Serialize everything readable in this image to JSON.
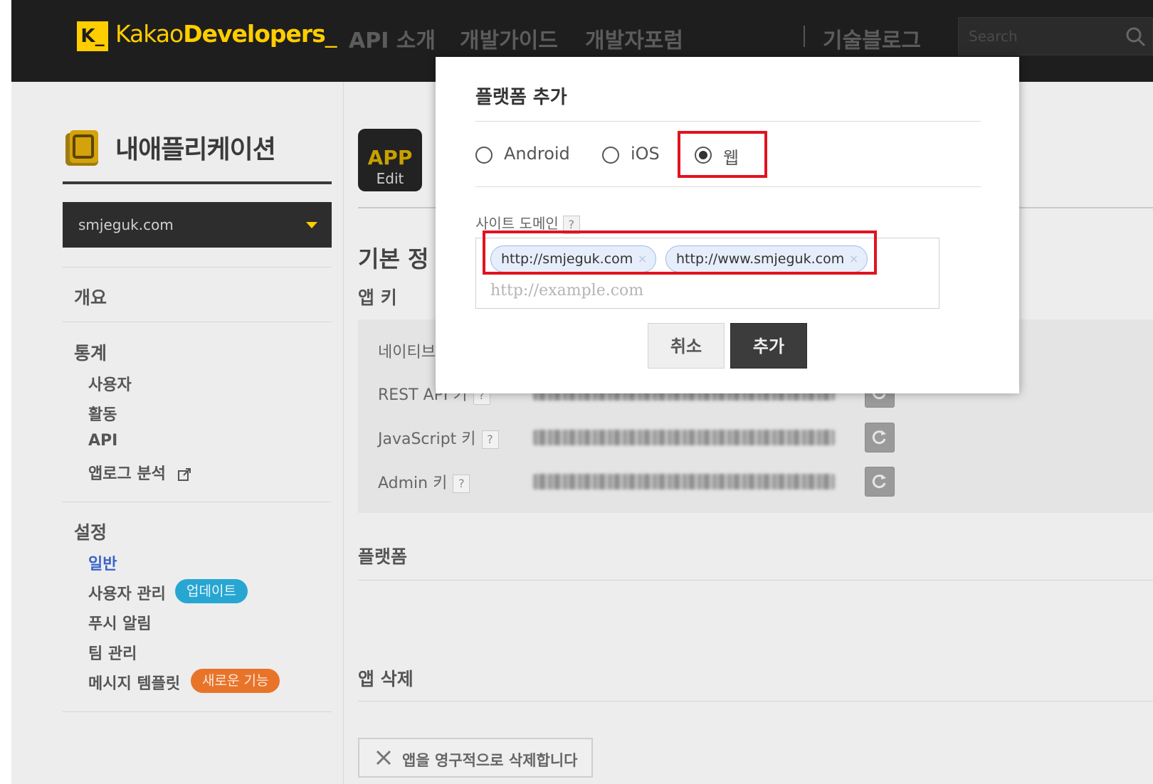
{
  "header": {
    "logo_badge": "K_",
    "logo_prefix": "Kakao",
    "logo_bold": "Developers",
    "logo_suffix": "_",
    "nav": [
      "API 소개",
      "개발가이드",
      "개발자포럼"
    ],
    "blog": "기술블로그",
    "search_placeholder": "Search"
  },
  "sidebar": {
    "title": "내애플리케이션",
    "selected_app": "smjeguk.com",
    "overview": "개요",
    "stats_head": "통계",
    "stats_items": [
      "사용자",
      "활동",
      "API",
      "앱로그 분석"
    ],
    "settings_head": "설정",
    "settings_items": [
      "일반",
      "사용자 관리",
      "푸시 알림",
      "팀 관리",
      "메시지 템플릿"
    ],
    "active_item": "일반",
    "badge_update": "업데이트",
    "badge_new": "새로운 기능"
  },
  "main": {
    "app_badge_top": "APP",
    "app_badge_bottom": "Edit",
    "section_basic": "기본 정",
    "app_key": "앱 키",
    "key_rows": [
      {
        "label": "네이티브"
      },
      {
        "label": "REST API 키"
      },
      {
        "label": "JavaScript 키"
      },
      {
        "label": "Admin 키"
      }
    ],
    "help_mark": "?",
    "platform": "플랫폼",
    "app_delete": "앱 삭제",
    "delete_button": "앱을 영구적으로 삭제합니다"
  },
  "modal": {
    "title": "플랫폼 추가",
    "options": [
      "Android",
      "iOS",
      "웹"
    ],
    "selected": "웹",
    "field_label": "사이트 도메인",
    "help_mark": "?",
    "tags": [
      "http://smjeguk.com",
      "http://www.smjeguk.com"
    ],
    "tag_remove": "×",
    "input_placeholder": "http://example.com",
    "cancel": "취소",
    "add": "추가"
  },
  "colors": {
    "brand_yellow": "#ffcd00",
    "highlight_red": "#e0131f",
    "active_blue": "#3b63c8",
    "badge_update": "#27a6d2",
    "badge_new": "#e8742a"
  }
}
